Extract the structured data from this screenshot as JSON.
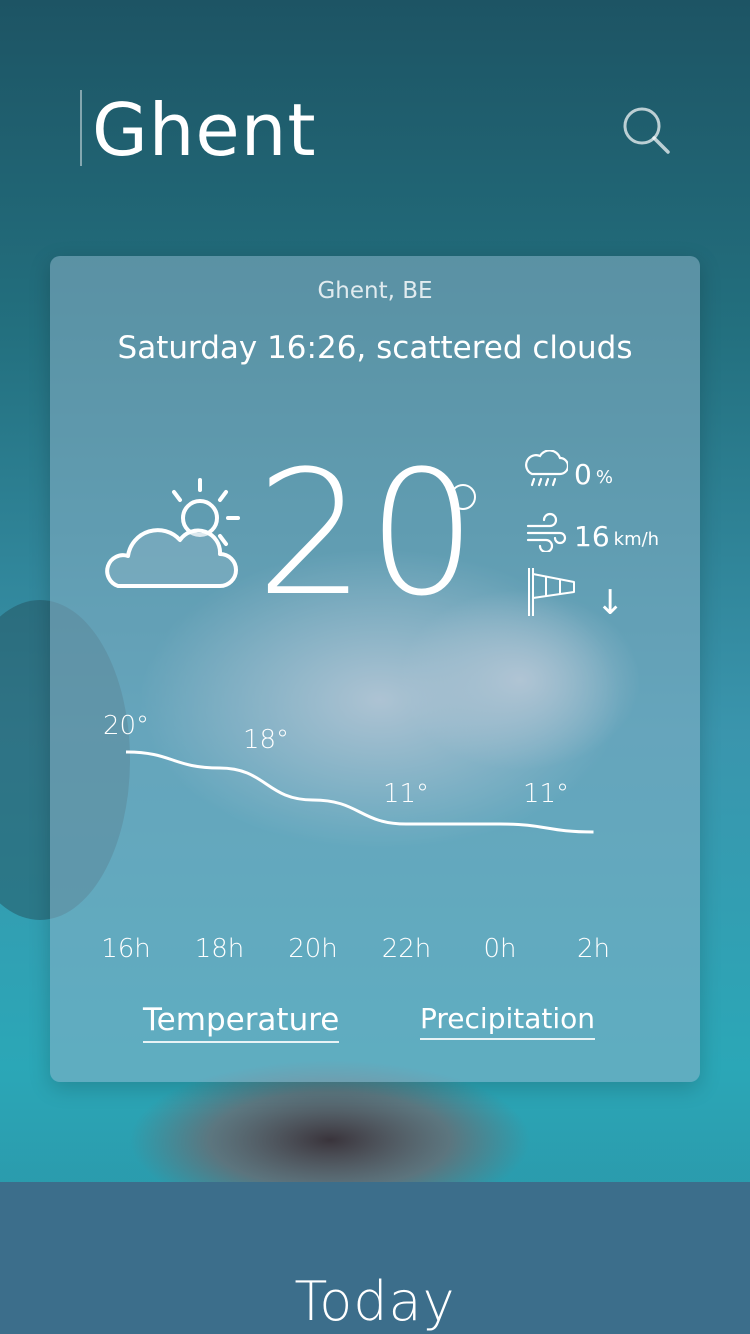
{
  "header": {
    "city": "Ghent"
  },
  "card": {
    "location": "Ghent, BE",
    "description": "Saturday 16:26, scattered clouds",
    "current_temp": "20",
    "condition_icon": "partly-cloudy-icon",
    "stats": {
      "precipitation": {
        "icon": "rain-cloud-icon",
        "value": "0",
        "unit": "%"
      },
      "wind_speed": {
        "icon": "wind-icon",
        "value": "16",
        "unit": "km/h"
      },
      "wind_direction": {
        "icon": "windsock-icon",
        "arrow": "↓"
      }
    }
  },
  "chart_data": {
    "type": "line",
    "x": [
      "16h",
      "18h",
      "20h",
      "22h",
      "0h",
      "2h"
    ],
    "series": [
      {
        "values": [
          20,
          18,
          14,
          11,
          11,
          10
        ]
      }
    ],
    "data_labels": [
      "20°",
      "18°",
      "11°",
      "11°"
    ]
  },
  "tabs": [
    {
      "label": "Temperature",
      "active": true
    },
    {
      "label": "Precipitation",
      "active": false
    }
  ],
  "bottom": {
    "label": "Today"
  },
  "colors": {
    "panel": "#3c6e8b",
    "card": "#8ab2c8",
    "sky_top": "#1e5566",
    "sky_mid": "#2d91a4"
  }
}
